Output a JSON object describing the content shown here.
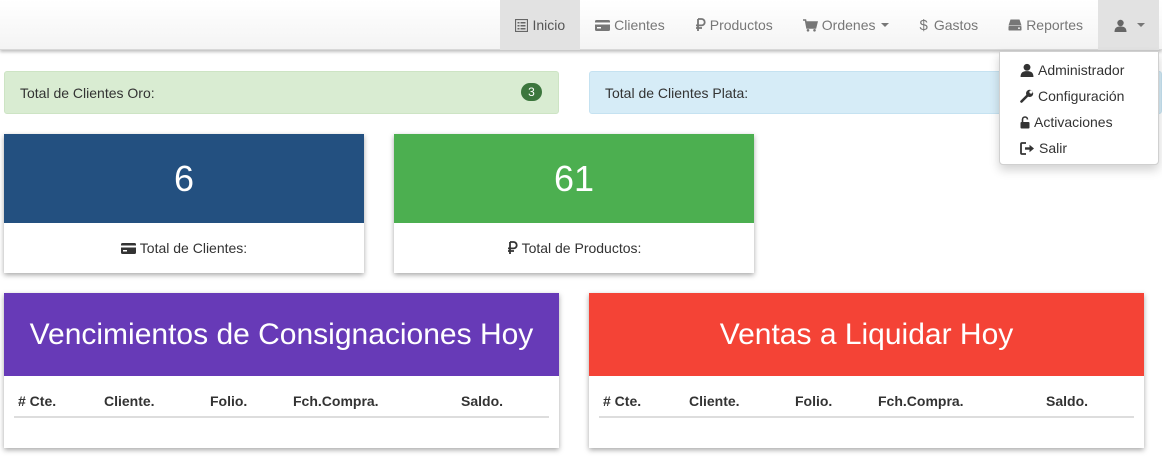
{
  "nav": {
    "items": [
      {
        "label": "Inicio",
        "icon": "list-alt-icon",
        "active": true
      },
      {
        "label": "Clientes",
        "icon": "credit-card-icon"
      },
      {
        "label": "Productos",
        "icon": "ruble-icon"
      },
      {
        "label": "Ordenes",
        "icon": "shopping-cart-icon",
        "dropdown": true
      },
      {
        "label": "Gastos",
        "icon": "dollar-icon"
      },
      {
        "label": "Reportes",
        "icon": "hdd-icon"
      }
    ],
    "user_icon": "user-icon"
  },
  "user_menu": {
    "items": [
      {
        "label": "Administrador",
        "icon": "user-icon"
      },
      {
        "label": "Configuración",
        "icon": "wrench-icon"
      },
      {
        "label": "Activaciones",
        "icon": "unlock-icon"
      },
      {
        "label": "Salir",
        "icon": "log-out-icon"
      }
    ]
  },
  "alerts": {
    "oro": {
      "label": "Total de Clientes Oro:",
      "count": "3"
    },
    "plata": {
      "label": "Total de Clientes Plata:"
    }
  },
  "stats": {
    "clientes": {
      "value": "6",
      "label": "Total de Clientes:"
    },
    "productos": {
      "value": "61",
      "label": "Total de Productos:"
    }
  },
  "panels": {
    "vencimientos": {
      "title": "Vencimientos de Consignaciones Hoy",
      "columns": [
        "# Cte.",
        "Cliente.",
        "Folio.",
        "Fch.Compra.",
        "Saldo."
      ]
    },
    "ventas": {
      "title": "Ventas a Liquidar Hoy",
      "columns": [
        "# Cte.",
        "Cliente.",
        "Folio.",
        "Fch.Compra.",
        "Saldo."
      ]
    }
  },
  "colors": {
    "navy": "#235080",
    "green": "#4caf50",
    "purple": "#673ab7",
    "red": "#f44336",
    "badge": "#3c763d"
  }
}
